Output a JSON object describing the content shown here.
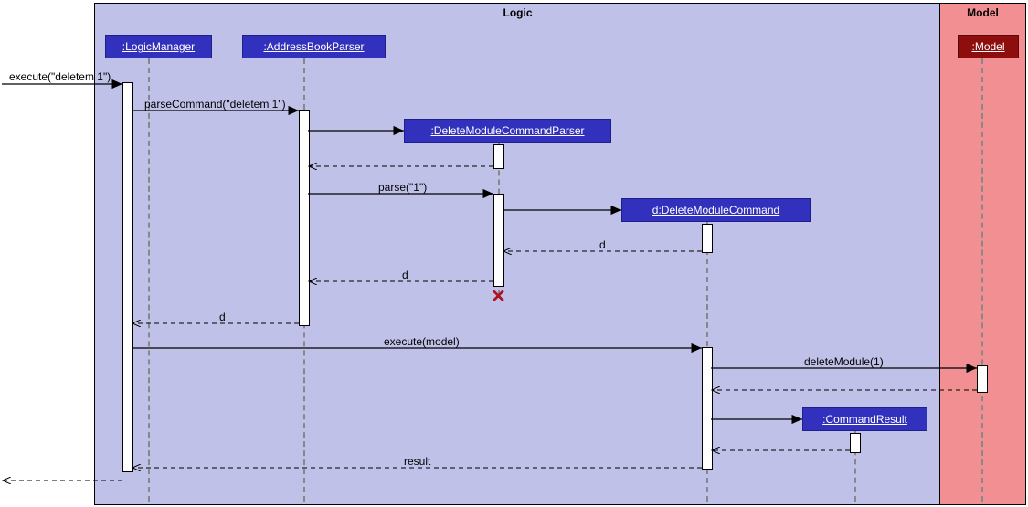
{
  "regions": {
    "logic_title": "Logic",
    "model_title": "Model"
  },
  "participants": {
    "logic_manager": ":LogicManager",
    "address_book_parser": ":AddressBookParser",
    "delete_module_command_parser": ":DeleteModuleCommandParser",
    "delete_module_command": "d:DeleteModuleCommand",
    "command_result": ":CommandResult",
    "model": ":Model"
  },
  "messages": {
    "execute_deletem": "execute(\"deletem 1\")",
    "parse_command": "parseCommand(\"deletem 1\")",
    "parse_one": "parse(\"1\")",
    "return_d1": "d",
    "return_d2": "d",
    "return_d3": "d",
    "execute_model": "execute(model)",
    "delete_module": "deleteModule(1)",
    "result": "result"
  }
}
